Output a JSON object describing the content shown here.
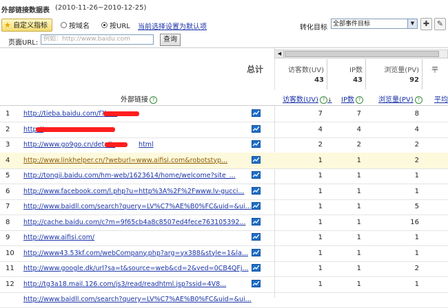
{
  "header": {
    "title": "外部链接数据表",
    "date_range": "(2010-11-26~2010-12-25)"
  },
  "toolbar": {
    "custom_metrics": "自定义指标",
    "by_domain": "按域名",
    "by_url": "按URL",
    "set_default": "当前选择设置为默认项",
    "goal_label": "转化目标",
    "goal_value": "全部事件目标"
  },
  "filter": {
    "url_label": "页面URL:",
    "url_placeholder": "例如：http://www.baidu.com",
    "query_button": "查询"
  },
  "summary": {
    "total_label": "总计",
    "cols": [
      {
        "label": "访客数(UV)",
        "value": "43"
      },
      {
        "label": "IP数",
        "value": "43"
      },
      {
        "label": "浏览量(PV)",
        "value": "92"
      },
      {
        "label": "平",
        "value": ""
      }
    ]
  },
  "table": {
    "ext_link_header": "外部链接",
    "columns": [
      "访客数(UV)",
      "IP数",
      "浏览量(PV)",
      "平均"
    ],
    "sort_icon": "sort-desc-icon",
    "rows": [
      {
        "n": "1",
        "url": "http://tieba.baidu.com/f?kz=",
        "uv": "7",
        "ip": "7",
        "pv": "8"
      },
      {
        "n": "2",
        "url": "http://",
        "uv": "4",
        "ip": "4",
        "pv": "4"
      },
      {
        "n": "3",
        "url": "http://www.go9go.cn/detail_",
        "url2": "html",
        "uv": "2",
        "ip": "2",
        "pv": "2"
      },
      {
        "n": "4",
        "url": "http://www.linkhelper.cn/?weburl=www.aifisi.com&robotstyp...",
        "uv": "1",
        "ip": "1",
        "pv": "2"
      },
      {
        "n": "5",
        "url": "http://tongji.baidu.com/hm-web/1623614/home/welcome?site_...",
        "uv": "1",
        "ip": "1",
        "pv": "1"
      },
      {
        "n": "6",
        "url": "http://www.facebook.com/l.php?u=http%3A%2F%2Fwww.lv-gucci...",
        "uv": "1",
        "ip": "1",
        "pv": "1"
      },
      {
        "n": "7",
        "url": "http://www.baidll.com/search?query=LV%C7%AE%B0%FC&uid=&ui...",
        "uv": "1",
        "ip": "1",
        "pv": "5"
      },
      {
        "n": "8",
        "url": "http://cache.baidu.com/c?m=9f65cb4a8c8507ed4fece763105392...",
        "uv": "1",
        "ip": "1",
        "pv": "16"
      },
      {
        "n": "9",
        "url": "http://www.aifisi.com/",
        "uv": "1",
        "ip": "1",
        "pv": "1"
      },
      {
        "n": "10",
        "url": "http://www43.53kf.com/webCompany.php?arg=yx388&style=1&la...",
        "uv": "1",
        "ip": "1",
        "pv": "1"
      },
      {
        "n": "11",
        "url": "http://www.google.dk/url?sa=t&source=web&cd=2&ved=0CB4QFj...",
        "uv": "1",
        "ip": "1",
        "pv": "2"
      },
      {
        "n": "12",
        "url": "http://tg3a18.mail.126.com/js3/read/readhtml.jsp?ssid=4V8...",
        "uv": "1",
        "ip": "1",
        "pv": "1"
      },
      {
        "n": "",
        "url": "http://www.baidll.com/search?query=LV%C7%AE%B0%FC&uid=&ui...",
        "uv": "",
        "ip": "",
        "pv": ""
      }
    ]
  },
  "colors": {
    "link": "#1a33a8",
    "highlight_row": "#fdf9dc",
    "redaction": "#ff1e1e",
    "trend_icon": "#1f6fc7"
  }
}
